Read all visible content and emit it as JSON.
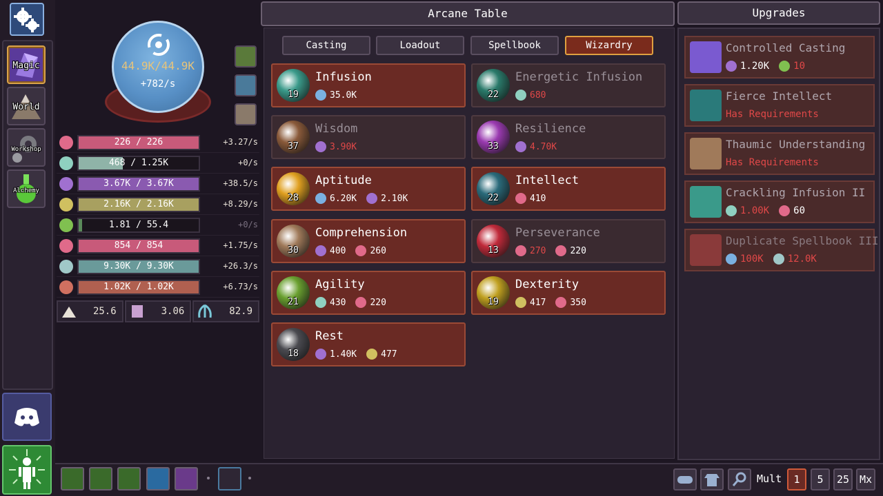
{
  "nav": {
    "items": [
      {
        "label": "Magic",
        "active": true
      },
      {
        "label": "World",
        "active": false
      },
      {
        "label": "Workshop",
        "active": false
      },
      {
        "label": "Alchemy",
        "active": false
      }
    ]
  },
  "mana": {
    "value": "44.9K",
    "max": "44.9K",
    "rate": "+782/s"
  },
  "resources": [
    {
      "icon": "heart-triad-icon",
      "current": "226",
      "max": "226",
      "rate": "+3.27/s",
      "color": "#c85a7a",
      "fill": 1.0
    },
    {
      "icon": "star-burst-icon",
      "current": "468",
      "max": "1.25K",
      "rate": "+0/s",
      "color": "#8fb3a8",
      "fill": 0.37
    },
    {
      "icon": "lotus-icon",
      "current": "3.67K",
      "max": "3.67K",
      "rate": "+38.5/s",
      "color": "#8a5ab0",
      "fill": 1.0
    },
    {
      "icon": "leaf-ring-icon",
      "current": "2.16K",
      "max": "2.16K",
      "rate": "+8.29/s",
      "color": "#a8a060",
      "fill": 1.0
    },
    {
      "icon": "sprout-icon",
      "current": "1.81",
      "max": "55.4",
      "rate": "+0/s",
      "color": "#5a8a5a",
      "fill": 0.03
    },
    {
      "icon": "heart-triad-icon",
      "current": "854",
      "max": "854",
      "rate": "+1.75/s",
      "color": "#c85a7a",
      "fill": 1.0
    },
    {
      "icon": "cube-icon",
      "current": "9.30K",
      "max": "9.30K",
      "rate": "+26.3/s",
      "color": "#6a9a9a",
      "fill": 1.0
    },
    {
      "icon": "scroll-icon",
      "current": "1.02K",
      "max": "1.02K",
      "rate": "+6.73/s",
      "color": "#b06050",
      "fill": 1.0
    }
  ],
  "mini_stats": [
    {
      "icon": "pages-icon",
      "value": "25.6"
    },
    {
      "icon": "parchment-icon",
      "value": "3.06"
    },
    {
      "icon": "tentacle-icon",
      "value": "82.9"
    }
  ],
  "center": {
    "title": "Arcane Table",
    "tabs": [
      "Casting",
      "Loadout",
      "Spellbook",
      "Wizardry"
    ],
    "active_tab": "Wizardry"
  },
  "spells": [
    {
      "name": "Infusion",
      "level": "19",
      "locked": false,
      "icon_color": "#3a9a8a",
      "costs": [
        {
          "icon": "swirl-icon",
          "value": "35.0K",
          "red": false
        }
      ]
    },
    {
      "name": "Energetic Infusion",
      "level": "22",
      "locked": true,
      "icon_color": "#2a7a6a",
      "costs": [
        {
          "icon": "star-burst-icon",
          "value": "680",
          "red": true
        }
      ]
    },
    {
      "name": "Wisdom",
      "level": "37",
      "locked": true,
      "icon_color": "#8a5a3a",
      "costs": [
        {
          "icon": "lotus-icon",
          "value": "3.90K",
          "red": true
        }
      ]
    },
    {
      "name": "Resilience",
      "level": "33",
      "locked": true,
      "icon_color": "#9a3ab0",
      "costs": [
        {
          "icon": "lotus-icon",
          "value": "4.70K",
          "red": true
        }
      ]
    },
    {
      "name": "Aptitude",
      "level": "28",
      "locked": false,
      "icon_color": "#e0a020",
      "costs": [
        {
          "icon": "swirl-icon",
          "value": "6.20K",
          "red": false
        },
        {
          "icon": "lotus-icon",
          "value": "2.10K",
          "red": false
        }
      ]
    },
    {
      "name": "Intellect",
      "level": "22",
      "locked": false,
      "icon_color": "#2a6a7a",
      "costs": [
        {
          "icon": "heart-triad-icon",
          "value": "410",
          "red": false
        }
      ]
    },
    {
      "name": "Comprehension",
      "level": "30",
      "locked": false,
      "icon_color": "#a07a5a",
      "costs": [
        {
          "icon": "lotus-icon",
          "value": "400",
          "red": false
        },
        {
          "icon": "heart-triad-icon",
          "value": "260",
          "red": false
        }
      ]
    },
    {
      "name": "Perseverance",
      "level": "13",
      "locked": true,
      "icon_color": "#c02a3a",
      "costs": [
        {
          "icon": "heart-triad-icon",
          "value": "270",
          "red": true
        },
        {
          "icon": "heart-triad-icon",
          "value": "220",
          "red": false
        }
      ]
    },
    {
      "name": "Agility",
      "level": "21",
      "locked": false,
      "icon_color": "#6aa030",
      "costs": [
        {
          "icon": "star-burst-icon",
          "value": "430",
          "red": false
        },
        {
          "icon": "heart-triad-icon",
          "value": "220",
          "red": false
        }
      ]
    },
    {
      "name": "Dexterity",
      "level": "19",
      "locked": false,
      "icon_color": "#c0a020",
      "costs": [
        {
          "icon": "leaf-ring-icon",
          "value": "417",
          "red": false
        },
        {
          "icon": "heart-triad-icon",
          "value": "350",
          "red": false
        }
      ]
    },
    {
      "name": "Rest",
      "level": "18",
      "locked": false,
      "icon_color": "#4a4a50",
      "costs": [
        {
          "icon": "lotus-icon",
          "value": "1.40K",
          "red": false
        },
        {
          "icon": "leaf-ring-icon",
          "value": "477",
          "red": false
        }
      ]
    }
  ],
  "upgrades_panel": {
    "title": "Upgrades",
    "items": [
      {
        "name": "Controlled Casting",
        "requirement": "",
        "icon_color": "#7a5ad0",
        "costs": [
          {
            "icon": "lotus-icon",
            "value": "1.20K",
            "red": false
          },
          {
            "icon": "sprout-icon",
            "value": "10",
            "red": true
          }
        ]
      },
      {
        "name": "Fierce Intellect",
        "requirement": "Has Requirements",
        "icon_color": "#2a7a7a",
        "costs": []
      },
      {
        "name": "Thaumic Understanding",
        "requirement": "Has Requirements",
        "icon_color": "#a07a5a",
        "costs": []
      },
      {
        "name": "Crackling Infusion II",
        "requirement": "",
        "icon_color": "#3a9a8a",
        "costs": [
          {
            "icon": "star-burst-icon",
            "value": "1.00K",
            "red": true
          },
          {
            "icon": "heart-triad-icon",
            "value": "60",
            "red": false
          }
        ]
      },
      {
        "name": "Duplicate Spellbook III",
        "requirement": "",
        "icon_color": "#8a3a3a",
        "costs": [
          {
            "icon": "swirl-icon",
            "value": "100K",
            "red": true
          },
          {
            "icon": "cube-icon",
            "value": "12.0K",
            "red": true
          }
        ]
      }
    ]
  },
  "bottom": {
    "mult_label": "Mult",
    "mult_options": [
      "1",
      "5",
      "25",
      "Mx"
    ],
    "mult_active": "1"
  },
  "colors": {
    "accent": "#e0a040",
    "danger": "#e04848",
    "panel": "#2a2230",
    "spell_active": "#6a2a24"
  }
}
